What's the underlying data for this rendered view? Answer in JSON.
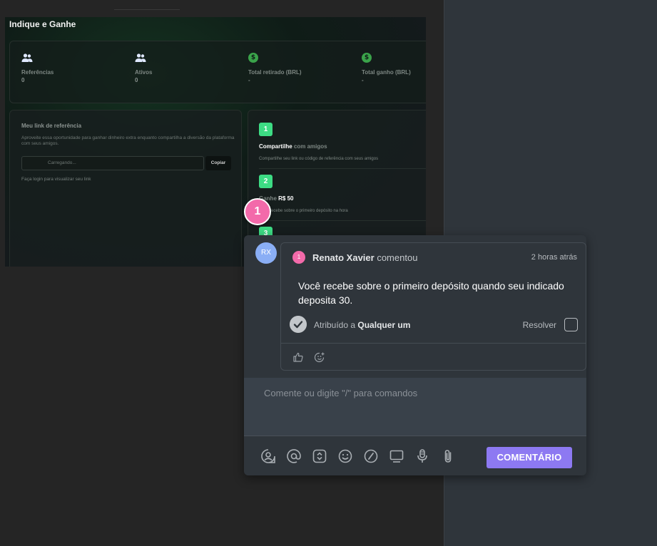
{
  "page": {
    "title": "Indique e Ganhe",
    "stats": [
      {
        "icon": "users-icon",
        "label": "Referências",
        "value": "0"
      },
      {
        "icon": "users-icon",
        "label": "Ativos",
        "value": "0"
      },
      {
        "icon": "dollar-coin-icon",
        "label": "Total retirado (BRL)",
        "value": "-"
      },
      {
        "icon": "dollar-coin-icon",
        "label": "Total ganho (BRL)",
        "value": "-"
      }
    ],
    "referral": {
      "title": "Meu link de referência",
      "description": "Aproveite essa oportunidade para ganhar dinheiro extra enquanto compartilha a diversão da plataforma com seus amigos.",
      "input_value": "Carregando...",
      "copy_label": "Copiar",
      "login_note": "Faça login para visualizar seu link"
    },
    "steps": [
      {
        "number": "1",
        "title_strong": "Compartilhe",
        "title_muted": "com amigos",
        "description": "Compartilhe seu link ou código de referência com seus amigos"
      },
      {
        "number": "2",
        "title_muted": "Ganhe",
        "title_strong": "R$ 50",
        "description": "Você recebe sobre o primeiro depósito na hora"
      },
      {
        "number": "3"
      }
    ],
    "coin_symbol": "$"
  },
  "pin": {
    "number": "1",
    "color": "#f36aaa"
  },
  "comment": {
    "avatar_initials": "RX",
    "avatar_color": "#8aaef5",
    "pin_number": "1",
    "author": "Renato Xavier",
    "action": "comentou",
    "timestamp": "2 horas atrás",
    "text": "Você recebe sobre o primeiro depósito quando seu indicado deposita 30.",
    "assigned_prefix": "Atribuído a",
    "assigned_to": "Qualquer um",
    "resolve_label": "Resolver",
    "reactions": [
      "thumbs-up-icon",
      "add-emoji-icon"
    ]
  },
  "composer": {
    "placeholder": "Comente ou digite \"/\" para comandos",
    "toolbar": [
      "mention-user-icon",
      "at-icon",
      "screenshot-icon",
      "emoji-icon",
      "slash-command-icon",
      "screen-record-icon",
      "microphone-icon",
      "attachment-icon"
    ],
    "submit_label": "COMENTÁRIO",
    "submit_color": "#8d79f2"
  }
}
